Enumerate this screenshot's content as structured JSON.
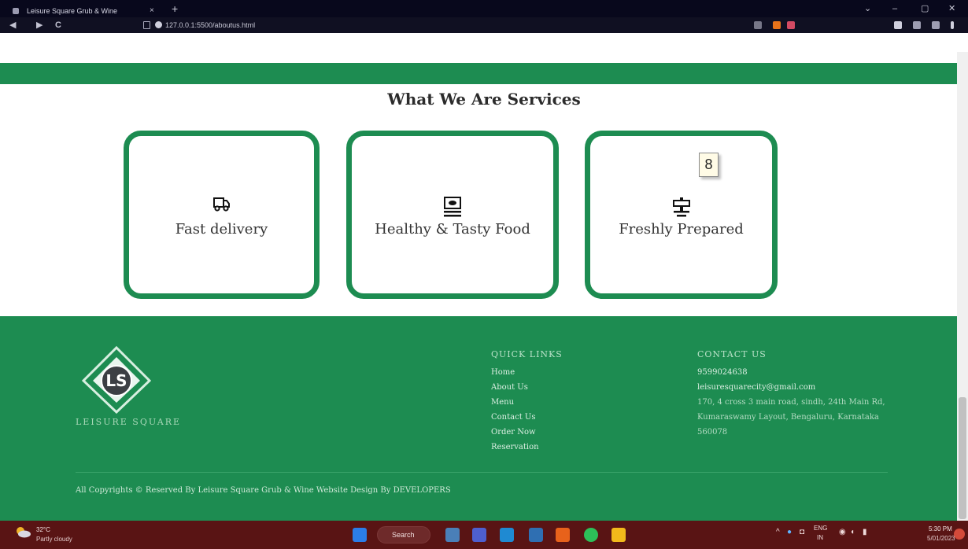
{
  "browser": {
    "tab_title": "Leisure Square Grub & Wine",
    "tab_close": "×",
    "new_tab": "+",
    "address": "127.0.0.1:5500/aboutus.html",
    "window_controls": [
      "⌄",
      "–",
      "▢",
      "✕"
    ],
    "nav_buttons": [
      "◀",
      "▶",
      "C"
    ]
  },
  "services": {
    "title": "What We Are Services",
    "cards": [
      {
        "label": "Fast delivery",
        "icon": "truck-icon"
      },
      {
        "label": "Healthy & Tasty Food",
        "icon": "food-tray-icon"
      },
      {
        "label": "Freshly Prepared",
        "icon": "signpost-icon"
      }
    ]
  },
  "tooltip": {
    "text": "8"
  },
  "footer": {
    "logo_letters": "LS",
    "brand_name": "LEISURE SQUARE",
    "quick_links": {
      "heading": "QUICK LINKS",
      "items": [
        "Home",
        "About Us",
        "Menu",
        "Contact Us",
        "Order Now",
        "Reservation"
      ]
    },
    "contact": {
      "heading": "CONTACT US",
      "phone": "9599024638",
      "email": "leisuresquarecity@gmail.com",
      "address": "170, 4 cross 3 main road, sindh, 24th Main Rd, Kumaraswamy Layout, Bengaluru, Karnataka 560078"
    },
    "copyright": "All Copyrights © Reserved By Leisure Square Grub & Wine Website Design By DEVELOPERS"
  },
  "taskbar": {
    "temp": "32°C",
    "weather": "Partly cloudy",
    "search_label": "Search",
    "lang": "ENG",
    "lang_sub": "IN",
    "time": "5:30 PM",
    "date": "5/01/2023"
  },
  "colors": {
    "brand_green": "#1d8c51",
    "taskbar": "#591414",
    "browser_chrome": "#08081c"
  }
}
